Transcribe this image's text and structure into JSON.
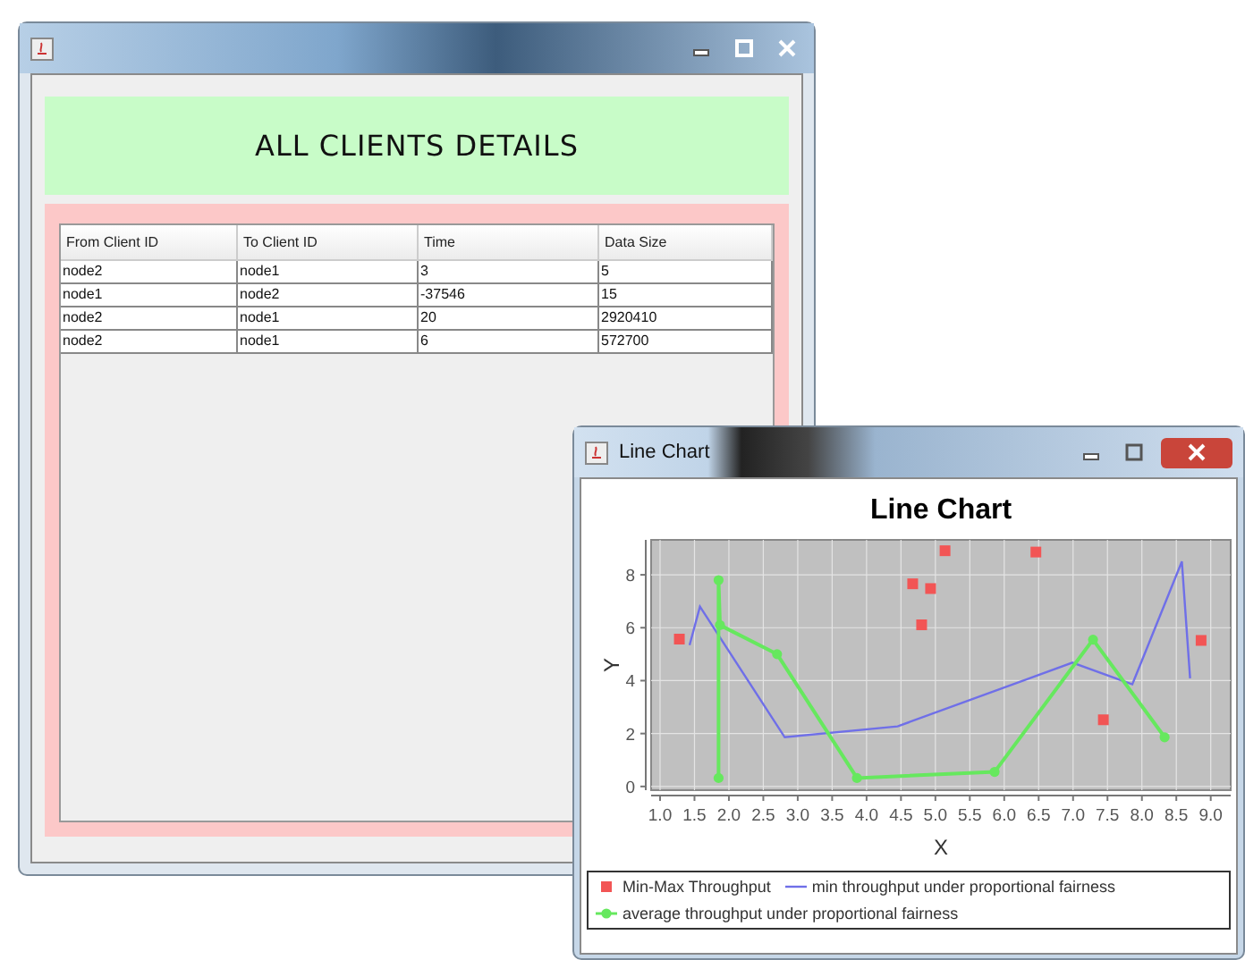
{
  "main_window": {
    "header": "ALL CLIENTS DETAILS",
    "table": {
      "columns": [
        "From Client ID",
        "To Client ID",
        "Time",
        "Data Size"
      ],
      "rows": [
        [
          "node2",
          "node1",
          "3",
          "5"
        ],
        [
          "node1",
          "node2",
          "-37546",
          "15"
        ],
        [
          "node2",
          "node1",
          "20",
          "2920410"
        ],
        [
          "node2",
          "node1",
          "6",
          "572700"
        ]
      ]
    }
  },
  "chart_window": {
    "title": "Line Chart",
    "chart_data": {
      "type": "line",
      "title": "Line Chart",
      "xlabel": "X",
      "ylabel": "Y",
      "xlim": [
        0.87,
        9.29
      ],
      "ylim": [
        -0.14,
        9.32
      ],
      "xticks": [
        {
          "value": 1,
          "label": "1.0"
        },
        {
          "value": 1.5,
          "label": "1.5"
        },
        {
          "value": 2,
          "label": "2.0"
        },
        {
          "value": 2.5,
          "label": "2.5"
        },
        {
          "value": 3,
          "label": "3.0"
        },
        {
          "value": 3.5,
          "label": "3.5"
        },
        {
          "value": 4,
          "label": "4.0"
        },
        {
          "value": 4.5,
          "label": "4.5"
        },
        {
          "value": 5,
          "label": "5.0"
        },
        {
          "value": 5.5,
          "label": "5.5"
        },
        {
          "value": 6,
          "label": "6.0"
        },
        {
          "value": 6.5,
          "label": "6.5"
        },
        {
          "value": 7,
          "label": "7.0"
        },
        {
          "value": 7.5,
          "label": "7.5"
        },
        {
          "value": 8,
          "label": "8.0"
        },
        {
          "value": 8.5,
          "label": "8.5"
        },
        {
          "value": 9,
          "label": "9.0"
        }
      ],
      "yticks": [
        0,
        2,
        4,
        6,
        8
      ],
      "grid": true,
      "series": [
        {
          "name": "Min-Max Throughput",
          "type": "scatter",
          "color": "#f25555",
          "x": [
            1.28,
            4.67,
            4.93,
            5.14,
            4.8,
            6.46,
            7.44,
            8.86
          ],
          "values": [
            5.57,
            7.66,
            7.48,
            8.91,
            6.11,
            8.86,
            2.52,
            5.52
          ]
        },
        {
          "name": "min throughput under proportional fairness",
          "type": "line",
          "color": "#6f6fe8",
          "x": [
            1.43,
            1.58,
            2.81,
            4.45,
            6.99,
            7.86,
            8.58,
            8.7
          ],
          "values": [
            5.34,
            6.8,
            1.86,
            2.27,
            4.68,
            3.86,
            8.5,
            4.09
          ]
        },
        {
          "name": "average throughput under proportional fairness",
          "type": "line",
          "marker": "circle",
          "color": "#66e85e",
          "x": [
            1.85,
            1.85,
            1.87,
            2.7,
            3.86,
            5.86,
            7.29,
            8.33
          ],
          "values": [
            0.32,
            7.8,
            6.1,
            5.0,
            0.32,
            0.55,
            5.55,
            1.86
          ]
        }
      ]
    }
  }
}
